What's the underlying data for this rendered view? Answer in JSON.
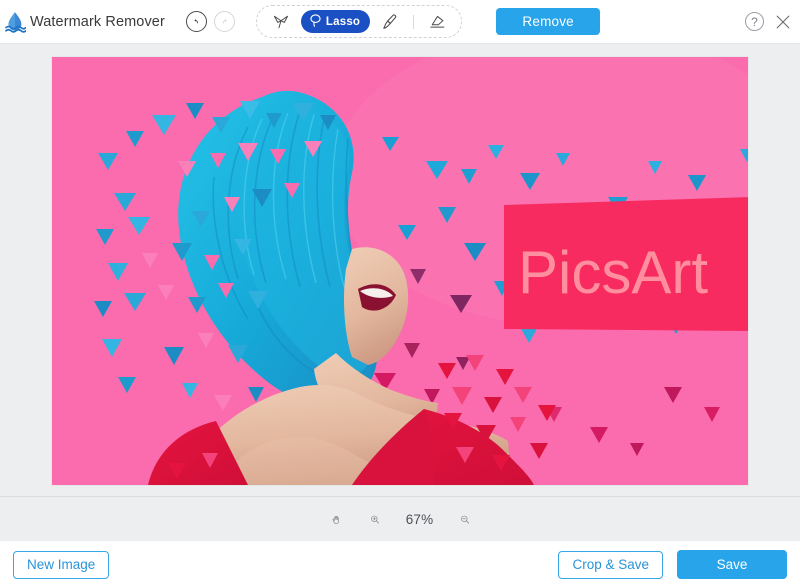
{
  "app": {
    "title": "Watermark Remover",
    "logo_icon": "water-drop-icon"
  },
  "header": {
    "undo_icon": "undo-arrow-icon",
    "redo_icon": "redo-arrow-icon",
    "help_label": "?",
    "help_icon": "help-circle-icon",
    "close_icon": "close-x-icon",
    "remove_label": "Remove",
    "accent_blue": "#27a4ea",
    "tool_active_blue": "#1b4fc4"
  },
  "tools": [
    {
      "name": "magic-wand-icon",
      "label": "",
      "active": false
    },
    {
      "name": "lasso-icon",
      "label": "Lasso",
      "active": true
    },
    {
      "name": "brush-icon",
      "label": "",
      "active": false
    },
    {
      "name": "eraser-icon",
      "label": "",
      "active": false
    }
  ],
  "canvas": {
    "photo_alt": "woman-with-blue-hair-dispersion-effect",
    "background": "#edeef0",
    "photo_bg": "#fb72b0",
    "selection": {
      "name": "lasso-selection-overlay",
      "watermark_text": "PicsArt",
      "fill": "#f72b5f",
      "text_color": "#ff8f9e"
    }
  },
  "zoombar": {
    "hand_icon": "hand-tool-icon",
    "zoom_in_icon": "zoom-in-icon",
    "zoom_out_icon": "zoom-out-icon",
    "zoom_level": "67%"
  },
  "footer": {
    "new_image_label": "New Image",
    "crop_save_label": "Crop & Save",
    "save_label": "Save"
  }
}
